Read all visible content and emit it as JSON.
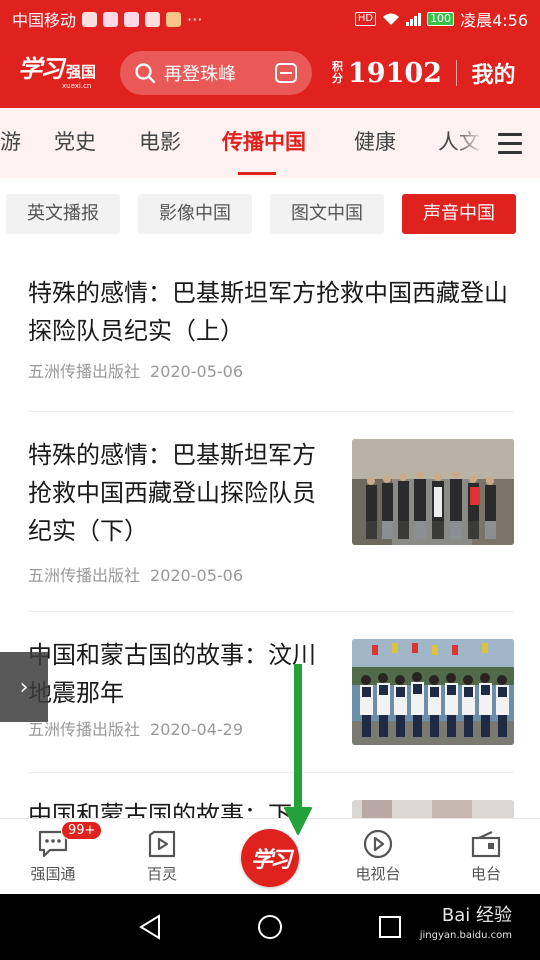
{
  "status_bar": {
    "carrier": "中国移动",
    "more": "···",
    "hd": "HD",
    "battery": "100",
    "time": "凌晨4:56"
  },
  "header": {
    "logo_text": "学习",
    "logo_sub": "强国",
    "logo_url": "xuexi.cn",
    "search_placeholder": "再登珠峰",
    "points_label": "积分",
    "points_value": "19102",
    "mine_label": "我的"
  },
  "channels": [
    {
      "label": "游"
    },
    {
      "label": "党史"
    },
    {
      "label": "电影"
    },
    {
      "label": "传播中国",
      "active": true
    },
    {
      "label": "健康"
    },
    {
      "label": "人文"
    }
  ],
  "subtabs": [
    {
      "label": "英文播报"
    },
    {
      "label": "影像中国"
    },
    {
      "label": "图文中国"
    },
    {
      "label": "声音中国",
      "active": true
    }
  ],
  "articles": [
    {
      "title": "特殊的感情：巴基斯坦军方抢救中国西藏登山探险队员纪实（上）",
      "source": "五洲传播出版社",
      "date": "2020-05-06",
      "has_image": false
    },
    {
      "title": "特殊的感情：巴基斯坦军方抢救中国西藏登山探险队员纪实（下）",
      "source": "五洲传播出版社",
      "date": "2020-05-06",
      "has_image": true
    },
    {
      "title": "中国和蒙古国的故事：汶川地震那年",
      "source": "五洲传播出版社",
      "date": "2020-04-29",
      "has_image": true
    },
    {
      "title": "中国和蒙古国的故事：下",
      "source": "",
      "date": "",
      "has_image": true
    }
  ],
  "bottom_nav": [
    {
      "label": "强国通",
      "icon": "chat-icon",
      "badge": "99+"
    },
    {
      "label": "百灵",
      "icon": "video-icon"
    },
    {
      "label": "学习",
      "icon": "study-logo"
    },
    {
      "label": "电视台",
      "icon": "play-icon"
    },
    {
      "label": "电台",
      "icon": "radio-icon"
    }
  ],
  "watermark": {
    "main": "Bai 经验",
    "sub": "jingyan.baidu.com"
  },
  "colors": {
    "brand_red": "#e0221f",
    "annotation_green": "#22a33a"
  }
}
